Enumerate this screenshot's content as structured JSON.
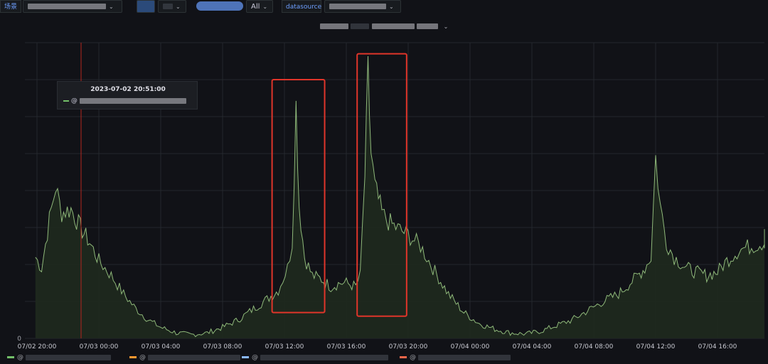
{
  "topbar": {
    "scene_label": "场景",
    "all_value": "All",
    "datasource_label": "datasource"
  },
  "panel": {
    "title": ""
  },
  "tooltip": {
    "time": "2023-07-02 20:51:00",
    "series_prefix": "@"
  },
  "legend": {
    "items": [
      {
        "label": "@",
        "color": "#73bf69"
      },
      {
        "label": "@",
        "color": "#ff9830"
      },
      {
        "label": "@",
        "color": "#8ab8ff"
      },
      {
        "label": "@",
        "color": "#f2664a"
      }
    ]
  },
  "colors": {
    "series": "#8fb97a",
    "fill": "#1f2a1e",
    "grid": "#24272c",
    "highlight": "#e0352a",
    "cursor": "#b3261e"
  },
  "chart_data": {
    "type": "area",
    "x_tick_labels": [
      "07/02 20:00",
      "07/03 00:00",
      "07/03 04:00",
      "07/03 08:00",
      "07/03 12:00",
      "07/03 16:00",
      "07/03 20:00",
      "07/04 00:00",
      "07/04 04:00",
      "07/04 08:00",
      "07/04 12:00",
      "07/04 16:00"
    ],
    "x_hours": [
      0,
      4,
      8,
      12,
      16,
      20,
      24,
      28,
      32,
      36,
      40,
      44
    ],
    "y_tick_labels": [
      "0",
      "",
      "",
      "",
      "",
      "",
      "",
      "",
      ""
    ],
    "y_max_units": 8,
    "series": [
      {
        "points_hours_value": [
          [
            -0.1,
            2.2
          ],
          [
            0.3,
            1.9
          ],
          [
            0.8,
            3.2
          ],
          [
            1.2,
            4.1
          ],
          [
            1.6,
            3.4
          ],
          [
            2.2,
            3.5
          ],
          [
            2.8,
            3.0
          ],
          [
            3.4,
            2.6
          ],
          [
            4.0,
            2.1
          ],
          [
            4.8,
            1.7
          ],
          [
            5.6,
            1.2
          ],
          [
            6.4,
            0.8
          ],
          [
            7.2,
            0.5
          ],
          [
            8.0,
            0.3
          ],
          [
            9.0,
            0.15
          ],
          [
            10.0,
            0.1
          ],
          [
            11.0,
            0.15
          ],
          [
            12.0,
            0.3
          ],
          [
            13.0,
            0.5
          ],
          [
            14.0,
            0.8
          ],
          [
            15.0,
            1.1
          ],
          [
            15.6,
            1.3
          ],
          [
            15.9,
            1.6
          ],
          [
            16.2,
            1.9
          ],
          [
            16.5,
            2.6
          ],
          [
            16.75,
            6.3
          ],
          [
            16.95,
            3.6
          ],
          [
            17.3,
            2.2
          ],
          [
            17.8,
            1.7
          ],
          [
            18.4,
            1.6
          ],
          [
            19.0,
            1.4
          ],
          [
            19.6,
            1.5
          ],
          [
            20.0,
            1.5
          ],
          [
            20.6,
            1.4
          ],
          [
            20.9,
            1.7
          ],
          [
            21.2,
            4.4
          ],
          [
            21.4,
            7.2
          ],
          [
            21.6,
            5.0
          ],
          [
            21.85,
            4.1
          ],
          [
            22.3,
            3.4
          ],
          [
            22.6,
            3.2
          ],
          [
            23.2,
            3.0
          ],
          [
            24.0,
            2.8
          ],
          [
            24.8,
            2.5
          ],
          [
            25.6,
            1.9
          ],
          [
            26.6,
            1.2
          ],
          [
            27.6,
            0.7
          ],
          [
            28.6,
            0.4
          ],
          [
            29.6,
            0.25
          ],
          [
            30.6,
            0.15
          ],
          [
            31.6,
            0.12
          ],
          [
            32.6,
            0.2
          ],
          [
            33.6,
            0.35
          ],
          [
            34.6,
            0.5
          ],
          [
            35.6,
            0.75
          ],
          [
            36.6,
            1.0
          ],
          [
            37.6,
            1.2
          ],
          [
            38.6,
            1.6
          ],
          [
            39.3,
            1.9
          ],
          [
            39.7,
            2.2
          ],
          [
            40.0,
            4.9
          ],
          [
            40.3,
            3.6
          ],
          [
            40.7,
            2.6
          ],
          [
            41.2,
            2.2
          ],
          [
            42.0,
            1.9
          ],
          [
            42.6,
            1.8
          ],
          [
            43.3,
            1.7
          ],
          [
            44.0,
            1.8
          ],
          [
            44.6,
            2.1
          ],
          [
            45.4,
            2.4
          ],
          [
            46.2,
            2.5
          ],
          [
            47.0,
            2.6
          ],
          [
            47.8,
            2.8
          ],
          [
            48.4,
            2.6
          ]
        ]
      }
    ]
  }
}
